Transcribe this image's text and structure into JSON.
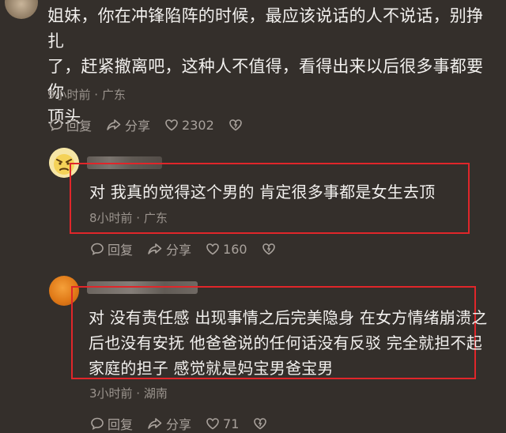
{
  "comments": [
    {
      "text": "姐妹，你在冲锋陷阵的时候，最应该说话的人不说话，别挣扎了，赶紧撤离吧，这种人不值得，看得出来以后很多事都要你顶头",
      "lines": [
        "姐妹，你在冲锋陷阵的时候，最应该说话的人不说话，别挣扎",
        "了，赶紧撤离吧，这种人不值得，看得出来以后很多事都要你",
        "顶头"
      ],
      "meta": "9小时前 · 广东",
      "reply": "回复",
      "share": "分享",
      "likes": "2302"
    },
    {
      "text": "对 我真的觉得这个男的 肯定很多事都是女生去顶",
      "meta": "8小时前 · 广东",
      "reply": "回复",
      "share": "分享",
      "likes": "160",
      "highlighted": true
    },
    {
      "text": "对 没有责任感 出现事情之后完美隐身 在女方情绪崩溃之后也没有安抚 他爸爸说的任何话没有反驳 完全就担不起家庭的担子 感觉就是妈宝男爸宝男",
      "lines": [
        "对 没有责任感 出现事情之后完美隐身 在女方情绪崩溃之",
        "后也没有安抚 他爸爸说的任何话没有反驳 完全就担不起",
        "家庭的担子 感觉就是妈宝男爸宝男"
      ],
      "meta": "3小时前 · 湖南",
      "reply": "回复",
      "share": "分享",
      "likes": "71",
      "highlighted": true
    }
  ],
  "colors": {
    "background": "#342f2b",
    "highlight_box": "#e0262a",
    "text": "#f2f0ee",
    "meta": "#9b948e"
  },
  "icons": [
    "comment-icon",
    "share-icon",
    "like-icon",
    "dislike-icon"
  ]
}
